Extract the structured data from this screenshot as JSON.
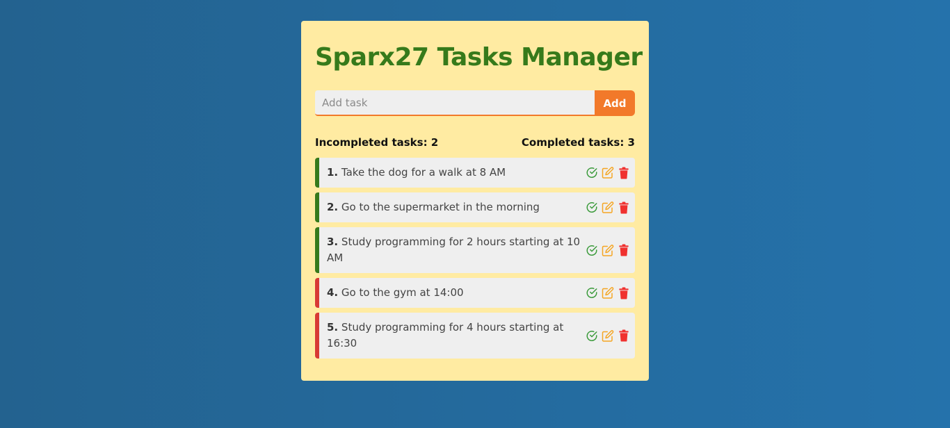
{
  "title": "Sparx27 Tasks Manager",
  "add": {
    "placeholder": "Add task",
    "value": "",
    "button_label": "Add"
  },
  "counts": {
    "incompleted": "Incompleted tasks: 2",
    "completed": "Completed tasks: 3"
  },
  "colors": {
    "background_start": "#23628f",
    "background_end": "#2572ab",
    "card": "#ffeba2",
    "title": "#367a1b",
    "accent": "#f2792a",
    "completed_border": "#367a1b",
    "incompleted_border": "#d83a35",
    "check_icon": "#3a9a3a",
    "edit_icon": "#f5a623",
    "delete_icon": "#f0312f"
  },
  "tasks": [
    {
      "number": "1.",
      "text": "Take the dog for a walk at 8 AM",
      "status": "completed"
    },
    {
      "number": "2.",
      "text": "Go to the supermarket in the morning",
      "status": "completed"
    },
    {
      "number": "3.",
      "text": "Study programming for 2 hours starting at 10 AM",
      "status": "completed"
    },
    {
      "number": "4.",
      "text": "Go to the gym at 14:00",
      "status": "incompleted"
    },
    {
      "number": "5.",
      "text": "Study programming for 4 hours starting at 16:30",
      "status": "incompleted"
    }
  ],
  "icons": {
    "complete": "check-circle-icon",
    "edit": "edit-icon",
    "delete": "trash-icon"
  }
}
